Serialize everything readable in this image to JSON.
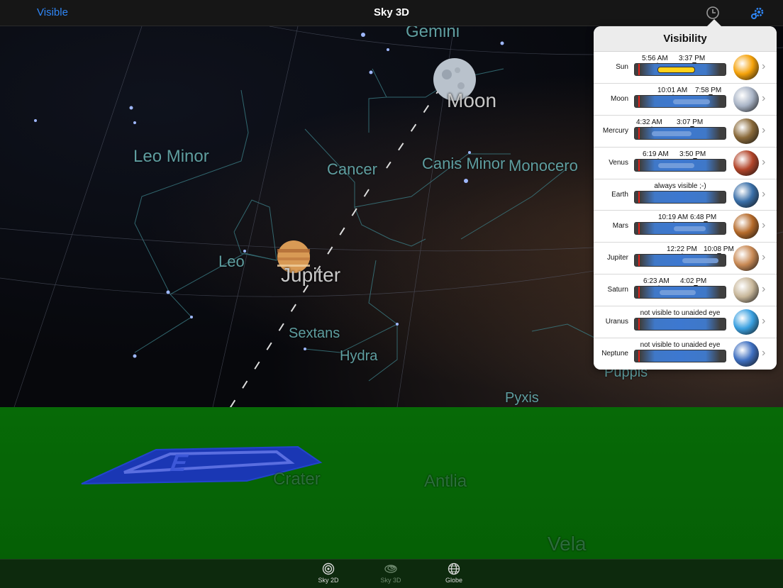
{
  "nav": {
    "left_label": "Visible",
    "title": "Sky 3D",
    "clock_icon": "clock-icon",
    "settings_icon": "gear-settings-icon"
  },
  "sky": {
    "constellations": [
      "Gemini",
      "Leo Minor",
      "Cancer",
      "Canis Minor",
      "Monocero",
      "Leo",
      "Sextans",
      "Hydra",
      "Pyxis",
      "Puppis"
    ],
    "planets": [
      "Moon",
      "Jupiter"
    ]
  },
  "ground": {
    "constellations": [
      "Crater",
      "Antlia",
      "Vela"
    ]
  },
  "tabs": [
    {
      "label": "Sky 2D",
      "icon": "target-icon"
    },
    {
      "label": "Sky 3D",
      "icon": "spiral-icon"
    },
    {
      "label": "Globe",
      "icon": "globe-icon"
    }
  ],
  "visibility": {
    "title": "Visibility",
    "rows": [
      {
        "name": "Sun",
        "rise": "5:56 AM",
        "set": "3:37 PM",
        "note": "",
        "color": "#f5a20a",
        "rise_frac": 0.25,
        "set_frac": 0.65
      },
      {
        "name": "Moon",
        "rise": "10:01 AM",
        "set": "7:58 PM",
        "note": "",
        "color": "#a9b4c6",
        "rise_frac": 0.42,
        "set_frac": 0.83
      },
      {
        "name": "Mercury",
        "rise": "4:32 AM",
        "set": "3:07 PM",
        "note": "",
        "color": "#8a6a3a",
        "rise_frac": 0.19,
        "set_frac": 0.63
      },
      {
        "name": "Venus",
        "rise": "6:19 AM",
        "set": "3:50 PM",
        "note": "",
        "color": "#b2452a",
        "rise_frac": 0.26,
        "set_frac": 0.66
      },
      {
        "name": "Earth",
        "rise": "",
        "set": "",
        "note": "always visible ;-)",
        "color": "#3a6fa8",
        "rise_frac": 0,
        "set_frac": 1
      },
      {
        "name": "Mars",
        "rise": "10:19 AM",
        "set": "6:48 PM",
        "note": "",
        "color": "#b56a2a",
        "rise_frac": 0.43,
        "set_frac": 0.78
      },
      {
        "name": "Jupiter",
        "rise": "12:22 PM",
        "set": "10:08 PM",
        "note": "",
        "color": "#c98a55",
        "rise_frac": 0.52,
        "set_frac": 0.92
      },
      {
        "name": "Saturn",
        "rise": "6:23 AM",
        "set": "4:02 PM",
        "note": "",
        "color": "#c8b79a",
        "rise_frac": 0.27,
        "set_frac": 0.67
      },
      {
        "name": "Uranus",
        "rise": "",
        "set": "",
        "note": "not visible to unaided eye",
        "color": "#3aa0e0",
        "rise_frac": 0,
        "set_frac": 0
      },
      {
        "name": "Neptune",
        "rise": "",
        "set": "",
        "note": "not visible to unaided eye",
        "color": "#3e6fc0",
        "rise_frac": 0,
        "set_frac": 0
      }
    ]
  }
}
